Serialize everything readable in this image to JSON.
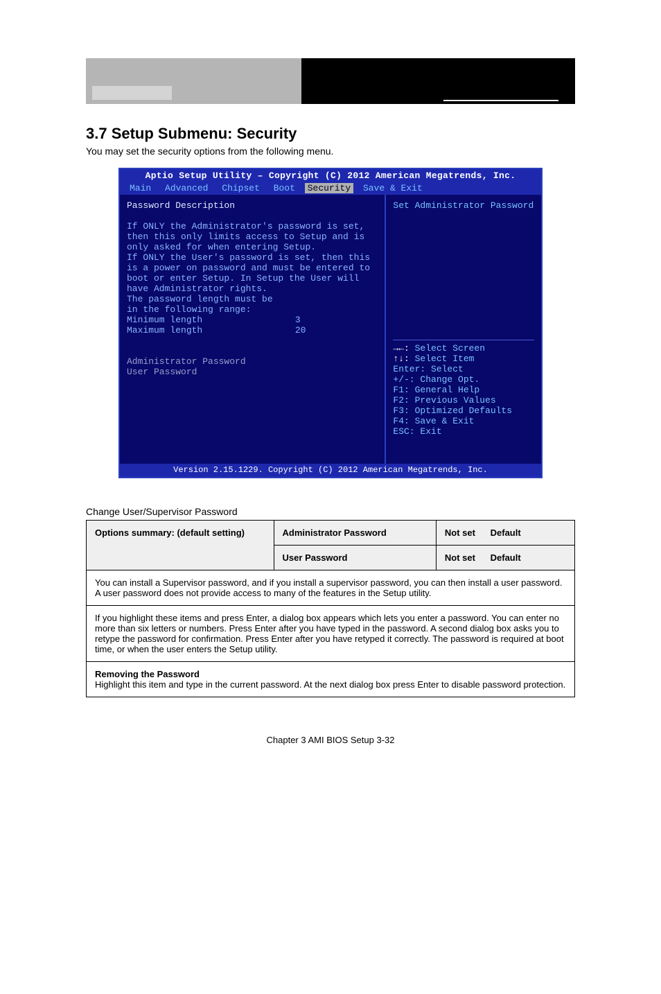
{
  "page": {
    "heading": "3.7 Setup Submenu: Security",
    "intro": "You may set the security options from the following menu.",
    "change_label": "Change User/Supervisor Password",
    "footer": "Chapter 3 AMI BIOS Setup           3-32"
  },
  "bios": {
    "title": "Aptio Setup Utility – Copyright (C) 2012 American Megatrends, Inc.",
    "menu": [
      "Main",
      "Advanced",
      "Chipset",
      "Boot",
      "Security",
      "Save & Exit"
    ],
    "menu_selected_idx": 4,
    "left_heading": "Password Description",
    "left_body": [
      "If ONLY the Administrator's password is set,",
      "then this only limits access to Setup and is",
      "only asked for when entering Setup.",
      "If ONLY the User's password is set, then this",
      "is a power on password and must be entered to",
      "boot or enter Setup. In Setup the User will",
      "have Administrator rights.",
      "The password length must be",
      "in the following range:"
    ],
    "min_label": "Minimum length",
    "min_val": "3",
    "max_label": "Maximum length",
    "max_val": "20",
    "admin_pw_label": "Administrator Password",
    "user_pw_label": "User Password",
    "right_title": "Set Administrator Password",
    "help": [
      {
        "k": "→←:",
        "v": " Select Screen"
      },
      {
        "k": "↑↓:",
        "v": " Select Item"
      },
      {
        "k": "Enter:",
        "v": " Select"
      },
      {
        "k": "+/-:",
        "v": " Change Opt."
      },
      {
        "k": "F1:",
        "v": " General Help"
      },
      {
        "k": "F2:",
        "v": " Previous Values"
      },
      {
        "k": "F3:",
        "v": " Optimized Defaults"
      },
      {
        "k": "F4:",
        "v": " Save & Exit"
      },
      {
        "k": "ESC:",
        "v": " Exit"
      }
    ],
    "footer": "Version 2.15.1229. Copyright (C) 2012 American Megatrends, Inc."
  },
  "table": {
    "hdr_opt": "Options summary: (default setting)",
    "hdr_c2": "Administrator Password",
    "hdr_c3a": "Not set",
    "hdr_c3b": "Default",
    "hdr_c2b": "User Password",
    "row1": {
      "c1": "You can install a Supervisor password, and if you install a supervisor password, you can then install a user password. A user password does not provide access to many of the features in the Setup utility."
    },
    "row2": {
      "c1": "If you highlight these items and press Enter, a dialog box appears which lets you enter a password. You can enter no more than six letters or numbers. Press Enter after you have typed in the password. A second dialog box asks you to retype the password for confirmation. Press Enter after you have retyped it correctly. The password is required at boot time, or when the user enters the Setup utility."
    },
    "row3_label": "Removing the Password",
    "row3_body": "Highlight this item and type in the current password. At the next dialog box press Enter to disable password protection."
  }
}
